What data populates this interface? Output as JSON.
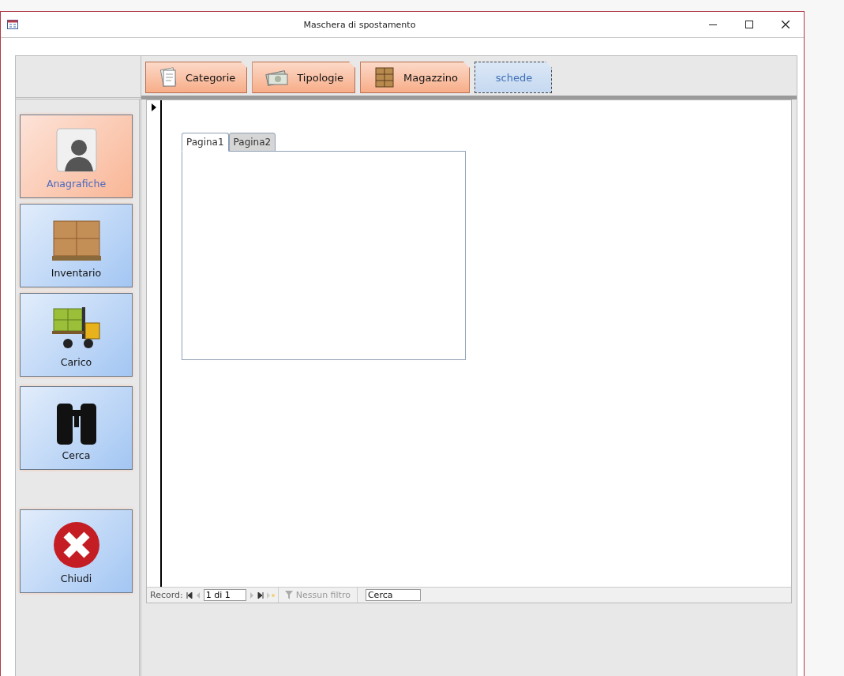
{
  "window": {
    "title": "Maschera di spostamento"
  },
  "top_buttons": [
    {
      "label": "Categorie",
      "kind": "documents",
      "focused": false
    },
    {
      "label": "Tipologie",
      "kind": "money",
      "focused": false
    },
    {
      "label": "Magazzino",
      "kind": "crates",
      "focused": false
    },
    {
      "label": "schede",
      "kind": "none",
      "focused": true
    }
  ],
  "side_buttons": [
    {
      "label": "Anagrafiche",
      "kind": "person",
      "highlighted": true
    },
    {
      "label": "Inventario",
      "kind": "boxes",
      "highlighted": false
    },
    {
      "label": "Carico",
      "kind": "forklift",
      "highlighted": false
    },
    {
      "label": "Cerca",
      "kind": "binoculars",
      "highlighted": false
    },
    {
      "label": "Chiudi",
      "kind": "close",
      "highlighted": false
    }
  ],
  "tabs": [
    {
      "label": "Pagina1",
      "selected": true
    },
    {
      "label": "Pagina2",
      "selected": false
    }
  ],
  "navigation": {
    "label": "Record:",
    "position": "1 di 1",
    "filter": "Nessun filtro",
    "search": {
      "placeholder": "Cerca"
    }
  }
}
